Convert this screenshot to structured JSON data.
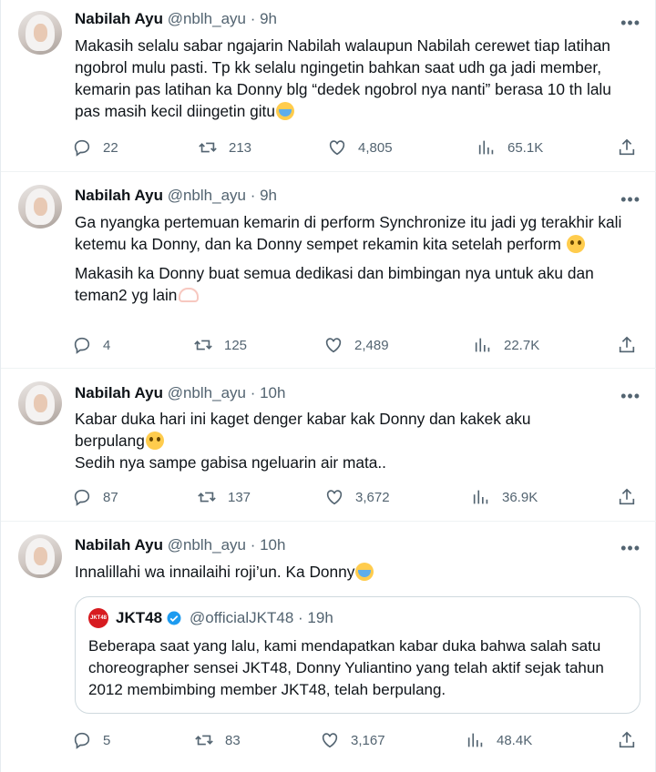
{
  "tweets": [
    {
      "author_name": "Nabilah Ayu",
      "meta": "@nblh_ayu · 9h",
      "text": "Makasih selalu sabar ngajarin Nabilah walaupun Nabilah cerewet tiap latihan ngobrol mulu pasti. Tp kk selalu ngingetin bahkan saat udh ga jadi member, kemarin pas latihan ka Donny blg “dedek ngobrol nya nanti” berasa 10 th lalu pas masih kecil diingetin gitu",
      "emoji": "loudly-crying-face-emoji",
      "replies": "22",
      "retweets": "213",
      "likes": "4,805",
      "views": "65.1K"
    },
    {
      "author_name": "Nabilah Ayu",
      "meta": "@nblh_ayu · 9h",
      "text1": "Ga nyangka pertemuan kemarin di perform Synchronize itu jadi yg terakhir kali ketemu ka Donny, dan ka Donny sempet rekamin kita setelah perform",
      "emoji1": "pleading-face-emoji",
      "text2": "Makasih ka Donny buat semua dedikasi dan bimbingan nya untuk aku dan teman2 yg lain",
      "emoji2": "heart-hands-emoji",
      "replies": "4",
      "retweets": "125",
      "likes": "2,489",
      "views": "22.7K"
    },
    {
      "author_name": "Nabilah Ayu",
      "meta": "@nblh_ayu · 10h",
      "text1": "Kabar duka hari ini kaget denger kabar kak Donny dan kakek aku berpulang",
      "emoji1": "pleading-face-emoji",
      "text2": "Sedih nya sampe gabisa ngeluarin air mata..",
      "replies": "87",
      "retweets": "137",
      "likes": "3,672",
      "views": "36.9K"
    },
    {
      "author_name": "Nabilah Ayu",
      "meta": "@nblh_ayu · 10h",
      "text": "Innalillahi wa innailaihi roji’un. Ka Donny",
      "emoji": "loudly-crying-face-emoji",
      "quote": {
        "logo_text": "JKT48",
        "name": "JKT48",
        "meta": "@officialJKT48 · 19h",
        "text": "Beberapa saat yang lalu, kami mendapatkan kabar duka bahwa salah satu choreographer sensei JKT48, Donny Yuliantino yang telah aktif sejak tahun 2012 membimbing member JKT48, telah berpulang."
      },
      "replies": "5",
      "retweets": "83",
      "likes": "3,167",
      "views": "48.4K"
    }
  ],
  "more_label": "•••",
  "colors": {
    "text": "#0f1419",
    "muted": "#536471",
    "verified": "#1d9bf0",
    "jkt48_red": "#d71b20"
  }
}
